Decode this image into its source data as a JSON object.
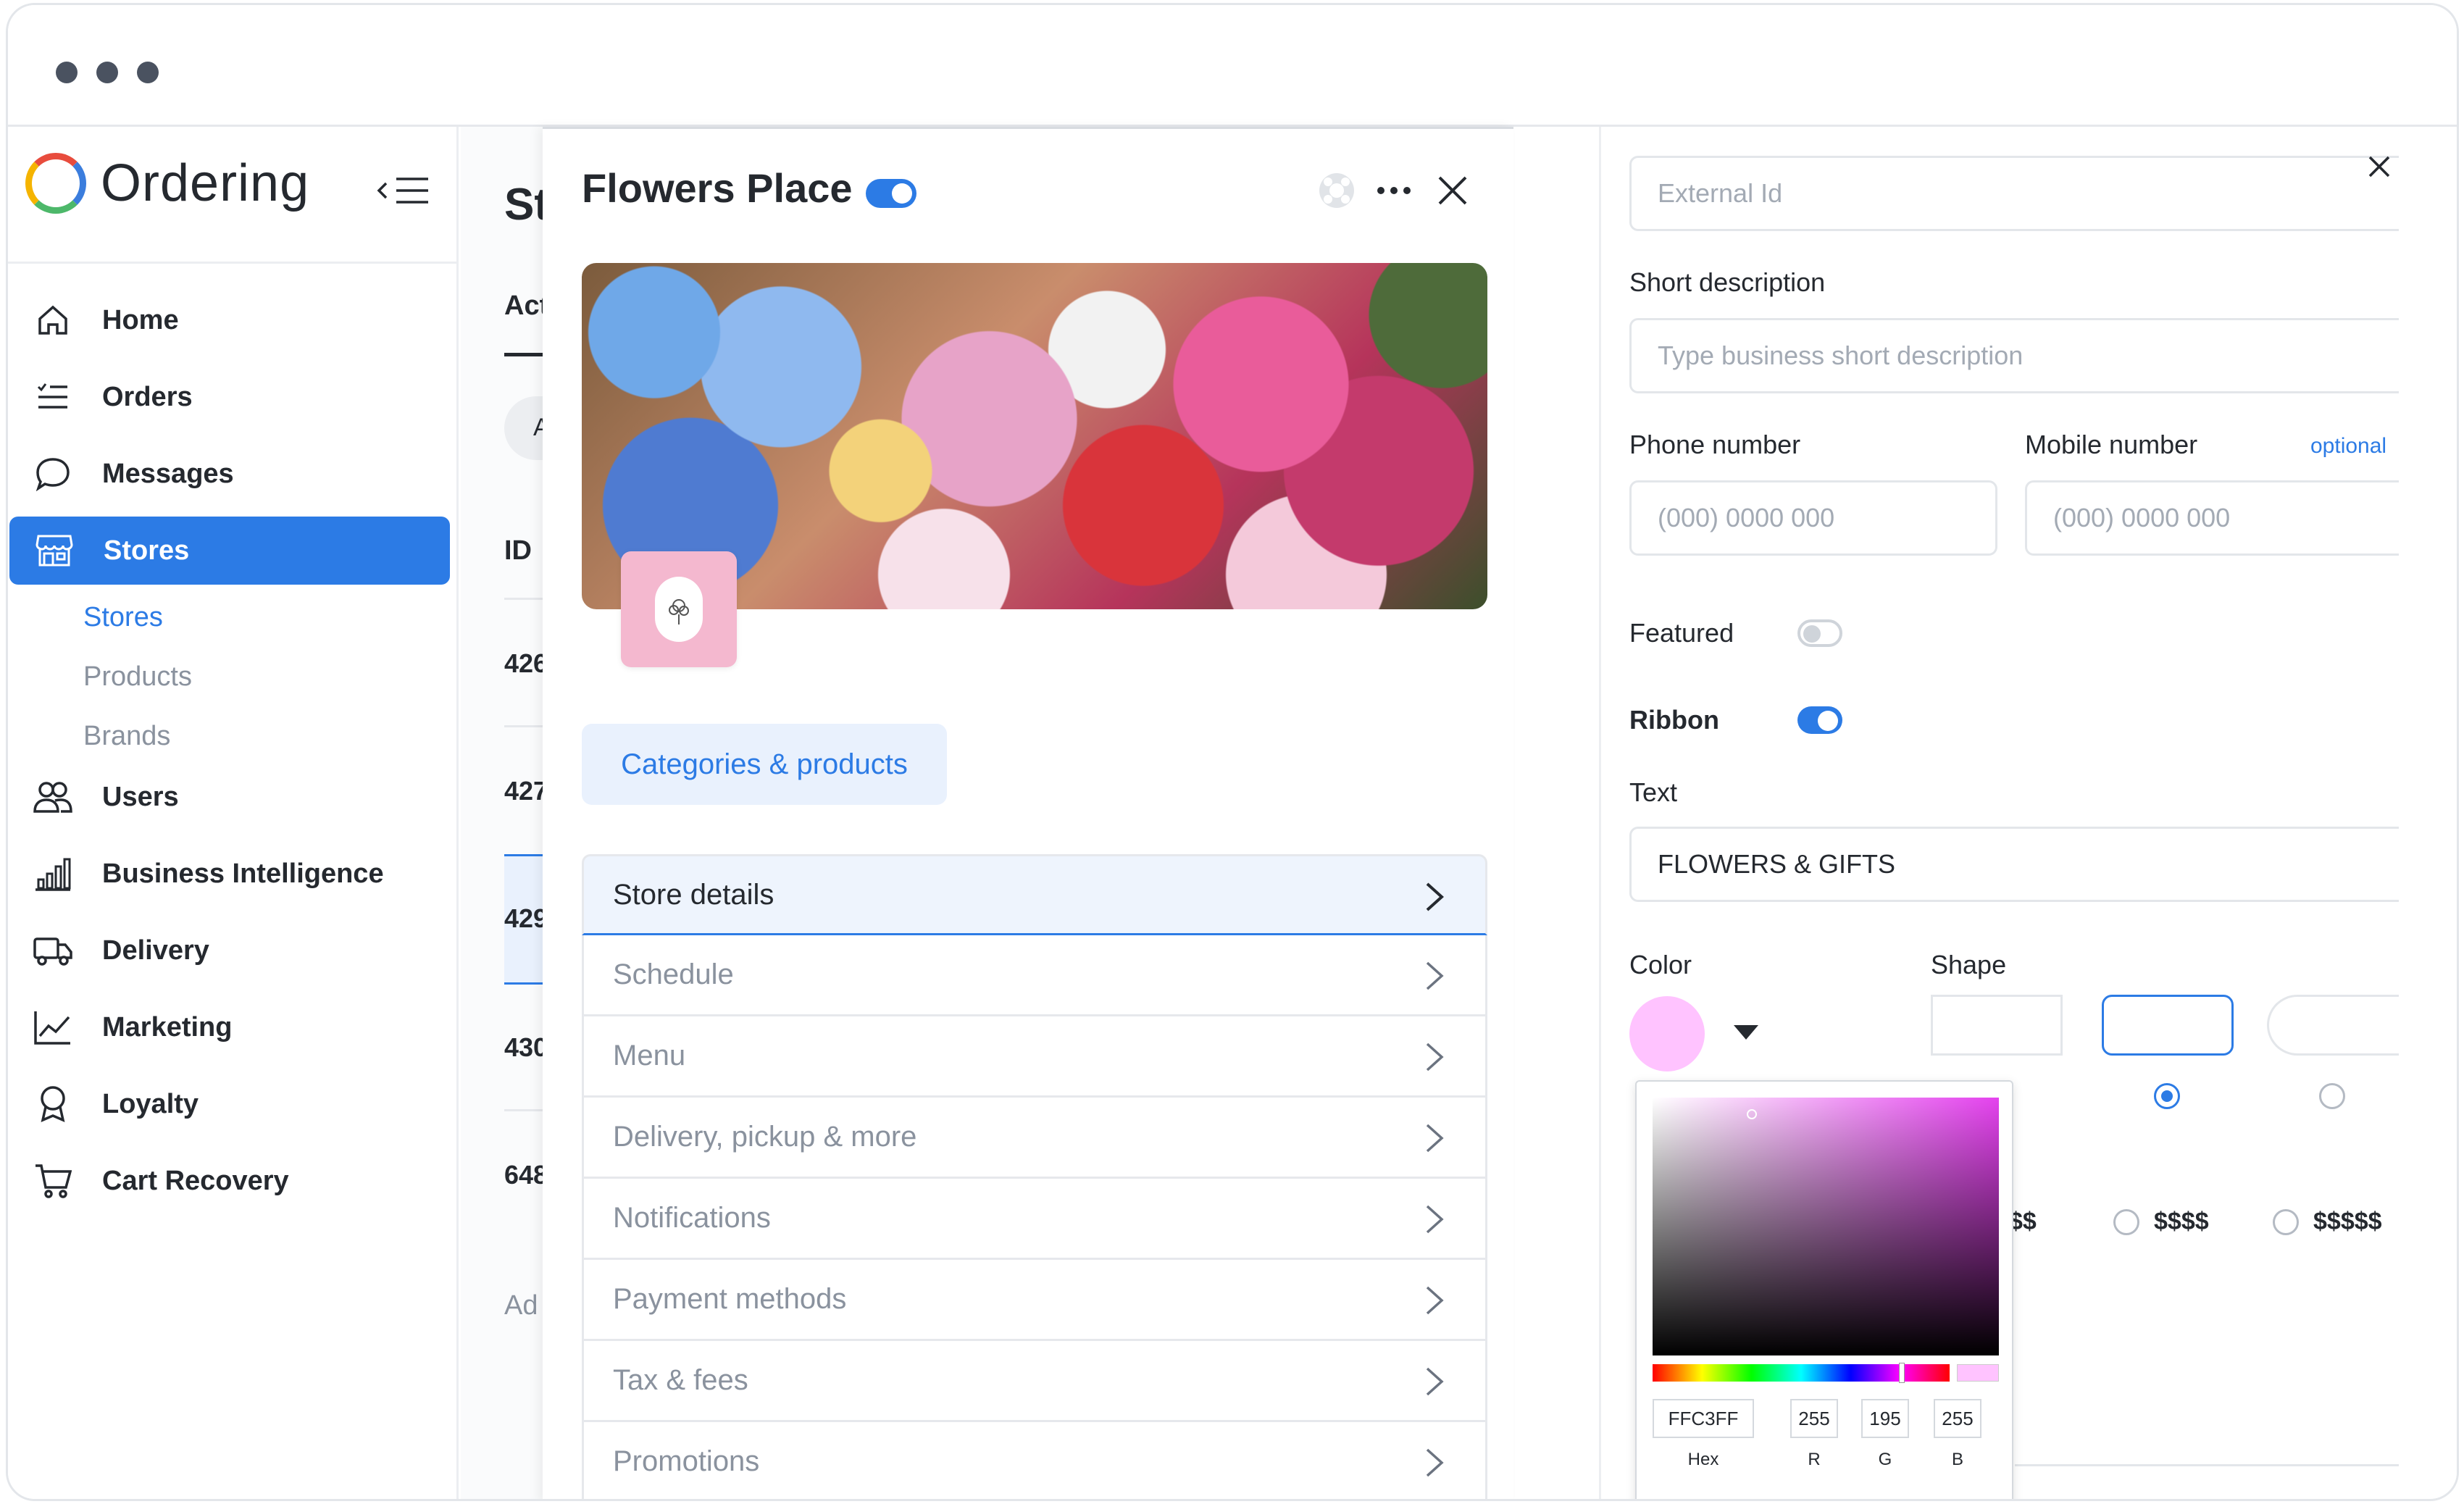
{
  "app": {
    "name": "Ordering"
  },
  "sidebar": {
    "items": [
      {
        "label": "Home",
        "icon": "home-icon"
      },
      {
        "label": "Orders",
        "icon": "list-icon"
      },
      {
        "label": "Messages",
        "icon": "chat-icon"
      },
      {
        "label": "Stores",
        "icon": "store-icon",
        "active": true
      },
      {
        "label": "Users",
        "icon": "users-icon"
      },
      {
        "label": "Business Intelligence",
        "icon": "bar-chart-icon"
      },
      {
        "label": "Delivery",
        "icon": "truck-icon"
      },
      {
        "label": "Marketing",
        "icon": "trend-icon"
      },
      {
        "label": "Loyalty",
        "icon": "award-icon"
      },
      {
        "label": "Cart Recovery",
        "icon": "cart-icon"
      }
    ],
    "subitems": [
      {
        "label": "Stores",
        "active": true
      },
      {
        "label": "Products"
      },
      {
        "label": "Brands"
      }
    ]
  },
  "list": {
    "title": "St",
    "tab": "Act",
    "header_id": "ID",
    "filter": "A",
    "rows": [
      "426",
      "427",
      "429",
      "430",
      "648"
    ],
    "add": "Ad"
  },
  "store": {
    "name": "Flowers Place",
    "enabled": true,
    "tab_label": "Categories & products",
    "menu": [
      "Store details",
      "Schedule",
      "Menu",
      "Delivery, pickup & more",
      "Notifications",
      "Payment methods",
      "Tax & fees",
      "Promotions"
    ]
  },
  "form": {
    "external_id_placeholder": "External Id",
    "short_desc_label": "Short description",
    "short_desc_placeholder": "Type business short description",
    "phone_label": "Phone number",
    "phone_placeholder": "(000) 0000 000",
    "mobile_label": "Mobile number",
    "mobile_optional": "optional",
    "mobile_placeholder": "(000) 0000 000",
    "featured_label": "Featured",
    "featured_on": false,
    "ribbon_label": "Ribbon",
    "ribbon_on": true,
    "text_label": "Text",
    "text_value": "FLOWERS & GIFTS",
    "color_label": "Color",
    "color_value": "#ffc3ff",
    "shape_label": "Shape",
    "price_options": [
      "$$",
      "$$$$",
      "$$$$$"
    ]
  },
  "picker": {
    "hex": "FFC3FF",
    "r": "255",
    "g": "195",
    "b": "255",
    "hex_label": "Hex",
    "r_label": "R",
    "g_label": "G",
    "b_label": "B"
  }
}
